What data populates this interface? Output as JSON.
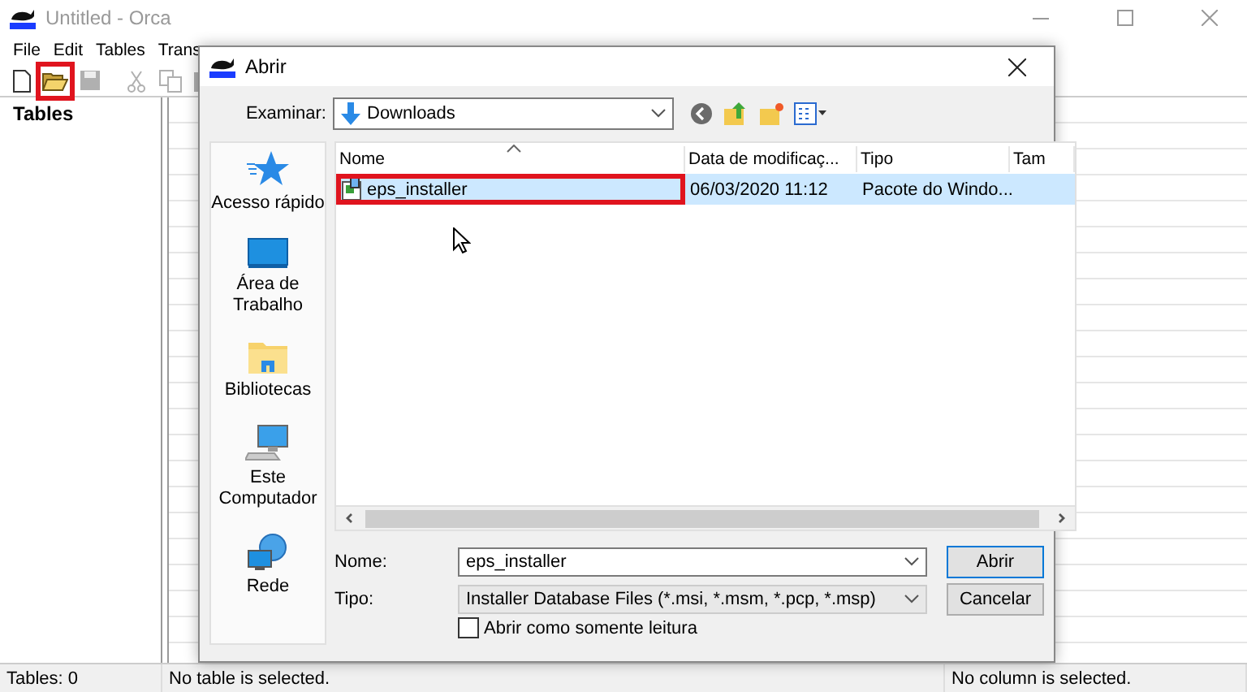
{
  "window": {
    "title": "Untitled - Orca"
  },
  "menu": [
    {
      "label": "File"
    },
    {
      "label": "Edit"
    },
    {
      "label": "Tables"
    },
    {
      "label": "Trans"
    }
  ],
  "toolbar": [
    {
      "kind": "new",
      "highlighted": false,
      "disabled": false
    },
    {
      "kind": "open",
      "highlighted": true,
      "disabled": false
    },
    {
      "kind": "save",
      "highlighted": false,
      "disabled": true
    },
    {
      "kind": "cut",
      "highlighted": false,
      "disabled": true
    },
    {
      "kind": "copy",
      "highlighted": false,
      "disabled": true
    },
    {
      "kind": "paste",
      "highlighted": false,
      "disabled": true
    }
  ],
  "tables_pane": {
    "header": "Tables"
  },
  "status_bar": {
    "tables": "Tables: 0",
    "table_status": "No table is selected.",
    "column_status": "No column is selected."
  },
  "dialog": {
    "title": "Abrir",
    "look_in": {
      "label": "Examinar:",
      "value": "Downloads"
    },
    "places": [
      {
        "kind": "star",
        "label": "Acesso rápido"
      },
      {
        "kind": "desktop",
        "label": "Área de Trabalho"
      },
      {
        "kind": "library",
        "label": "Bibliotecas"
      },
      {
        "kind": "computer",
        "label": "Este Computador"
      },
      {
        "kind": "network",
        "label": "Rede"
      }
    ],
    "columns": [
      "Nome",
      "Data de modificaç...",
      "Tipo",
      "Tam"
    ],
    "files": [
      {
        "name": "eps_installer",
        "date": "06/03/2020 11:12",
        "type": "Pacote do Windo...",
        "selected": true,
        "highlighted": true
      }
    ],
    "file_name": {
      "label": "Nome:",
      "value": "eps_installer"
    },
    "file_type": {
      "label": "Tipo:",
      "value": "Installer Database Files (*.msi, *.msm, *.pcp, *.msp)"
    },
    "read_only": {
      "label": "Abrir como somente leitura",
      "checked": false
    },
    "buttons": [
      {
        "label": "Abrir",
        "default": true
      },
      {
        "label": "Cancelar",
        "default": false
      }
    ]
  }
}
